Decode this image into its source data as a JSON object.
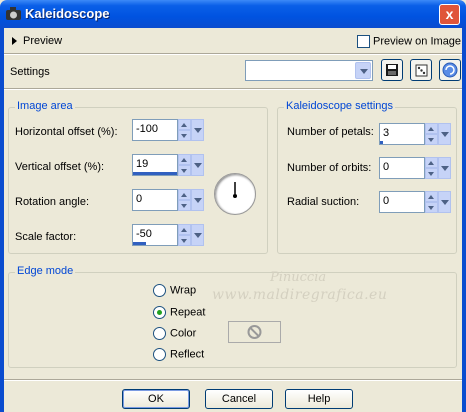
{
  "window": {
    "title": "Kaleidoscope",
    "close": "x"
  },
  "preview": {
    "label": "Preview",
    "on_image_label": "Preview on Image",
    "on_image_checked": false
  },
  "settings": {
    "label": "Settings",
    "preset_value": ""
  },
  "image_area": {
    "title": "Image area",
    "horizontal_offset": {
      "label": "Horizontal offset (%):",
      "value": "-100"
    },
    "vertical_offset": {
      "label": "Vertical offset (%):",
      "value": "19"
    },
    "rotation_angle": {
      "label": "Rotation angle:",
      "value": "0"
    },
    "scale_factor": {
      "label": "Scale factor:",
      "value": "-50"
    }
  },
  "kaleidoscope_settings": {
    "title": "Kaleidoscope settings",
    "number_of_petals": {
      "label": "Number of petals:",
      "value": "3"
    },
    "number_of_orbits": {
      "label": "Number of orbits:",
      "value": "0"
    },
    "radial_suction": {
      "label": "Radial suction:",
      "value": "0"
    }
  },
  "edge_mode": {
    "title": "Edge mode",
    "options": [
      "Wrap",
      "Repeat",
      "Color",
      "Reflect"
    ],
    "selected": "Repeat"
  },
  "watermark": {
    "line1": "Pinuccia",
    "line2": "www.maldiregrafica.eu"
  },
  "buttons": {
    "ok": "OK",
    "cancel": "Cancel",
    "help": "Help"
  },
  "colors": {
    "titlebar": "#0053e0",
    "group_title": "#0046d5",
    "dialog_bg": "#ece9d8"
  },
  "icons": [
    "app-icon",
    "save-icon",
    "randomize-icon",
    "reset-icon",
    "dial-icon",
    "no-color-icon"
  ]
}
